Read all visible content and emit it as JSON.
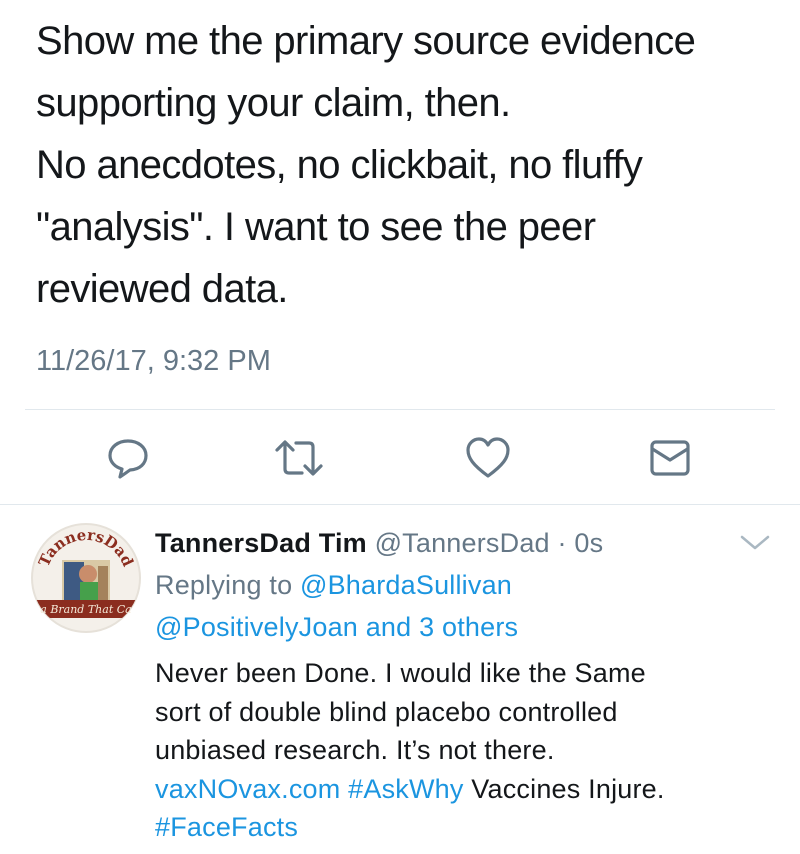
{
  "tweet": {
    "lines": [
      "Show me the primary source evidence",
      "supporting your claim, then.",
      "No anecdotes, no clickbait, no fluffy",
      "\"analysis\". I want to see the peer",
      "reviewed data."
    ],
    "timestamp": "11/26/17, 9:32 PM",
    "actions": [
      "reply-icon",
      "retweet-icon",
      "like-icon",
      "direct-message-icon"
    ]
  },
  "reply": {
    "display_name": "TannersDad Tim",
    "handle": "@TannersDad",
    "separator": "·",
    "time": "0s",
    "replying_prefix": "Replying to",
    "replying_user_1": "@BhardaSullivan",
    "replying_user_2": "@PositivelyJoan",
    "replying_and": "and",
    "replying_others": "3 others",
    "body_lines": [
      "Never been Done. I would like the Same",
      "sort of double blind placebo controlled",
      "unbiased research. It’s not there."
    ],
    "link": "vaxNOvax.com",
    "hashtag_1": "#AskWhy",
    "trailing_text": "Vaccines Injure.",
    "hashtag_2": "#FaceFacts",
    "avatar_text_top": "TannersDad",
    "avatar_text_banner": "a Brand That Ca",
    "menu_icon": "chevron-down-icon"
  },
  "colors": {
    "link": "#1b95e0",
    "secondary_text": "#657786",
    "action_icon": "#657786",
    "divider": "#e1e8ed",
    "avatar_ring": "#8b2d1f"
  }
}
